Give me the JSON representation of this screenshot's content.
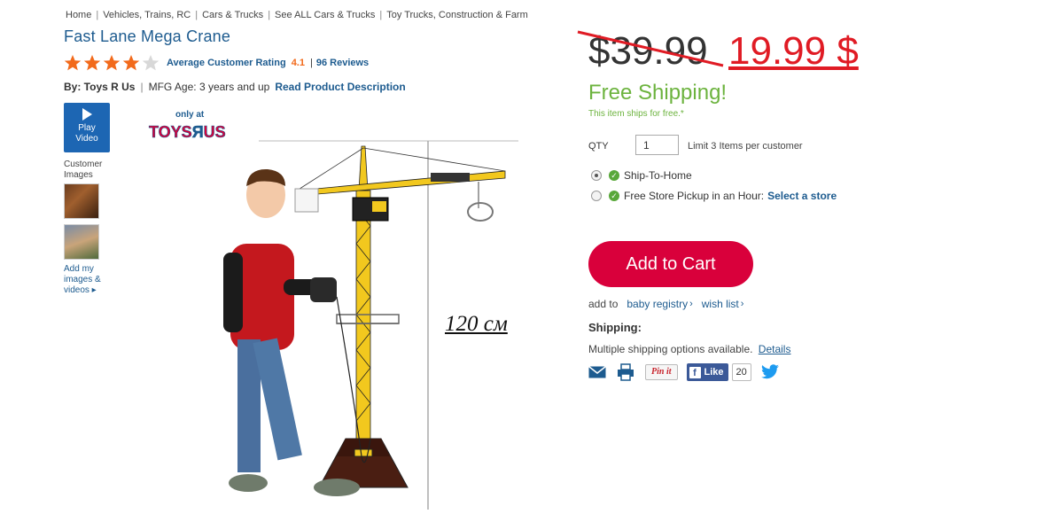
{
  "breadcrumb": [
    "Home",
    "Vehicles, Trains, RC",
    "Cars & Trucks",
    "See ALL Cars & Trucks",
    "Toy Trucks, Construction & Farm"
  ],
  "product": {
    "title": "Fast Lane Mega Crane",
    "rating_label": "Average Customer Rating",
    "rating_value": "4.1",
    "rating_stars": 4,
    "rating_max": 5,
    "reviews": "96 Reviews",
    "by": "By: Toys R Us",
    "mfg_age": "MFG Age: 3 years and up",
    "read_description": "Read Product Description",
    "measurement": "120 см"
  },
  "media": {
    "play_label": "Play",
    "video_label": "Video",
    "customer_images_label": "Customer Images",
    "add_media_label": "Add my images & videos ▸",
    "logo_small": "only at",
    "logo_brand": "TOYS R US"
  },
  "pricing": {
    "old_price": "$39.99",
    "new_price": "19.99 $",
    "free_shipping": "Free Shipping!",
    "ships_free_note": "This item ships for free.*"
  },
  "purchase": {
    "qty_label": "QTY",
    "qty_value": "1",
    "qty_limit": "Limit 3 Items per customer",
    "option_ship": "Ship-To-Home",
    "option_pickup": "Free Store Pickup in an Hour:",
    "select_store": "Select a store",
    "add_to_cart": "Add to Cart",
    "add_to": "add to",
    "baby_registry": "baby registry",
    "wish_list": "wish list",
    "shipping_heading": "Shipping:",
    "shipping_text": "Multiple shipping options available.",
    "details": "Details"
  },
  "social": {
    "pin": "Pin it",
    "fb_like": "Like",
    "fb_count": "20"
  },
  "colors": {
    "link": "#1d5b8f",
    "sale": "#e01b24",
    "free": "#6cb33e",
    "cart": "#d9003b",
    "star": "#f26a1b"
  },
  "icons": [
    "star-icon",
    "play-icon",
    "check-icon",
    "mail-icon",
    "print-icon",
    "facebook-icon",
    "twitter-icon"
  ]
}
